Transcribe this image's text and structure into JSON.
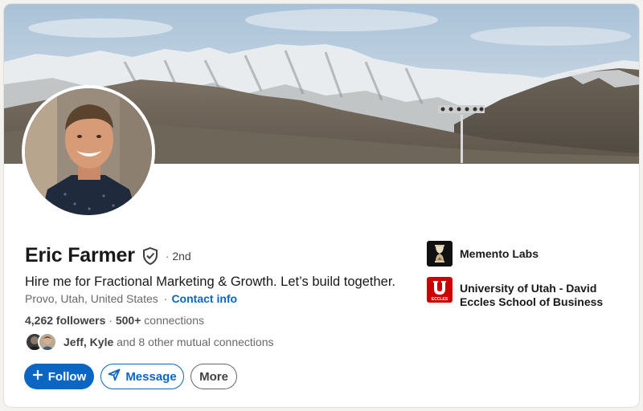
{
  "profile": {
    "name": "Eric Farmer",
    "degree": "2nd",
    "headline": "Hire me for Fractional Marketing & Growth. Let’s build together.",
    "location": "Provo, Utah, United States",
    "contact_info_label": "Contact info",
    "followers_count": "4,262 followers",
    "connections_count": "500+",
    "connections_label": "connections",
    "mutual_names": "Jeff, Kyle",
    "mutual_rest": "and 8 other mutual connections"
  },
  "actions": {
    "follow_label": "Follow",
    "message_label": "Message",
    "more_label": "More"
  },
  "right_column": {
    "company": {
      "name": "Memento Labs",
      "icon": "hourglass-logo"
    },
    "school": {
      "name": "University of Utah - David Eccles School of Business",
      "icon": "university-of-utah-logo",
      "logo_text": "ECCLES"
    }
  },
  "icons": {
    "verification": "shield-check-icon",
    "follow": "plus-icon",
    "message": "paper-plane-icon"
  },
  "colors": {
    "accent": "#0a66c2",
    "utah_red": "#cc0000"
  }
}
